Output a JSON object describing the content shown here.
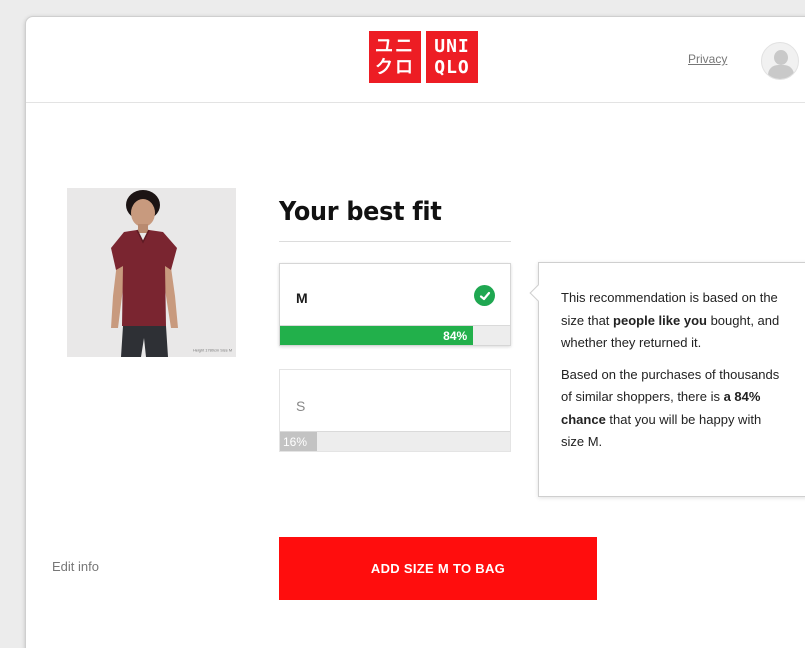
{
  "brand": {
    "logo_kana_top": "ユニ",
    "logo_kana_bottom": "クロ",
    "logo_latin_top": "UNI",
    "logo_latin_bottom": "QLO",
    "color": "#ed1d24"
  },
  "header": {
    "privacy_label": "Privacy",
    "avatar_icon": "user-avatar-icon"
  },
  "product": {
    "image_caption": "Height 1780cm Size M",
    "shirt_color": "#7a2530"
  },
  "recommendation": {
    "title": "Your best fit",
    "sizes": [
      {
        "label": "M",
        "percent": 84,
        "percent_label": "84%",
        "selected": true,
        "bar_color": "#22b04b"
      },
      {
        "label": "S",
        "percent": 16,
        "percent_label": "16%",
        "selected": false,
        "bar_color": "#c3c3c3"
      }
    ],
    "check_icon": "check-circle-icon"
  },
  "tooltip": {
    "p1_before": "This recommendation is based on the size that ",
    "p1_bold": "people like you",
    "p1_after": " bought, and whether they returned it.",
    "p2_before": "Based on the purchases of thousands of similar shoppers, there is ",
    "p2_bold": "a 84% chance",
    "p2_after": " that you will be happy with size M."
  },
  "actions": {
    "edit_info_label": "Edit info",
    "add_button_label": "ADD SIZE M TO BAG",
    "add_button_color": "#ff0d0d"
  }
}
